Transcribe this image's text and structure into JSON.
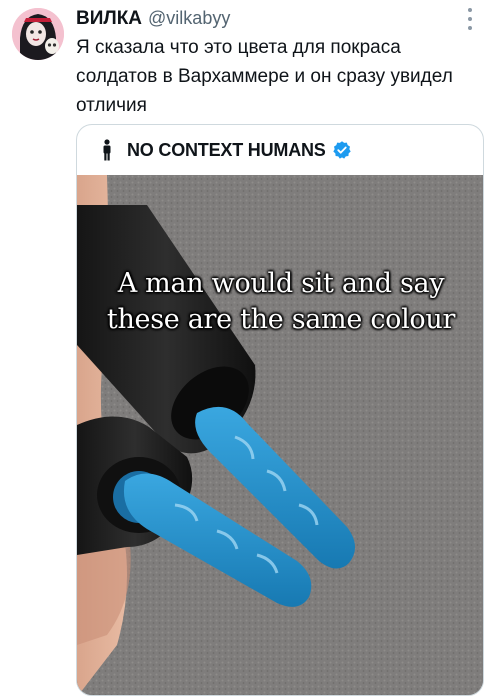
{
  "tweet": {
    "display_name": "ВИЛКА",
    "handle": "@vilkabyy",
    "text": "Я сказала что это цвета для покраса солдатов в Вархаммере и он сразу увидел отличия"
  },
  "quoted": {
    "account_name": "NO CONTEXT HUMANS",
    "verified": true,
    "media": {
      "caption_line_1": "A man would sit and say",
      "caption_line_2": "these are the same colour"
    }
  },
  "colors": {
    "verified_badge": "#1d9bf0",
    "polish_blue": "#1e8fcf",
    "background_gray": "#7d7b7a",
    "border": "#cfd9de"
  },
  "icons": {
    "menu": "more-vertical-icon",
    "account": "person-standing-icon",
    "badge": "verified-badge-icon"
  }
}
